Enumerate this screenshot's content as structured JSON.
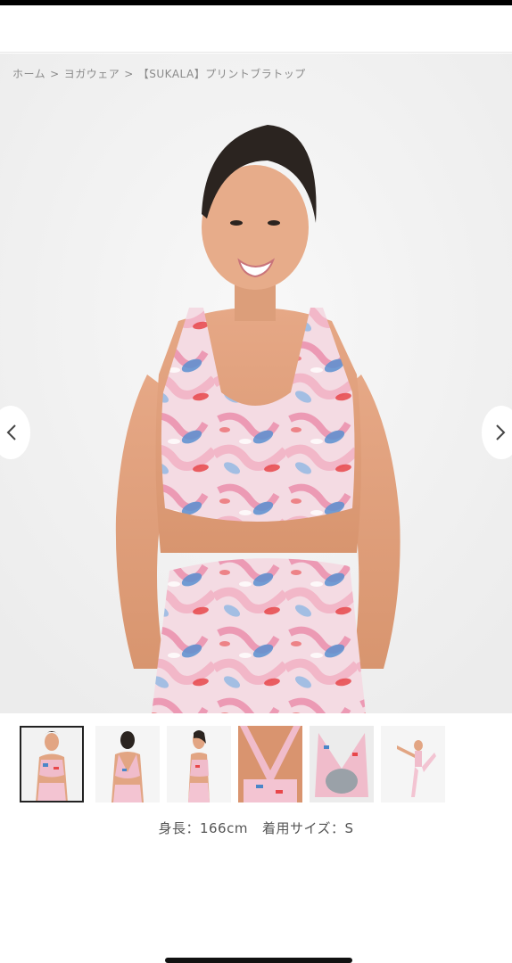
{
  "breadcrumb": {
    "items": [
      "ホーム",
      "ヨガウェア",
      "【SUKALA】プリントブラトップ"
    ],
    "separator": ">"
  },
  "gallery": {
    "main_image_alt": "model wearing printed bra top",
    "prev_icon": "chevron-left-icon",
    "next_icon": "chevron-right-icon",
    "thumbnails": [
      {
        "alt": "front view",
        "active": true
      },
      {
        "alt": "back view",
        "active": false
      },
      {
        "alt": "side view",
        "active": false
      },
      {
        "alt": "back strap detail",
        "active": false
      },
      {
        "alt": "product flat back",
        "active": false
      },
      {
        "alt": "yoga pose",
        "active": false
      }
    ]
  },
  "caption": {
    "height_label": "身長：166cm",
    "size_label": "着用サイズ：S"
  },
  "colors": {
    "accent_pink": "#e97b9a",
    "accent_blue": "#4a86c8",
    "accent_red": "#e8474a"
  }
}
